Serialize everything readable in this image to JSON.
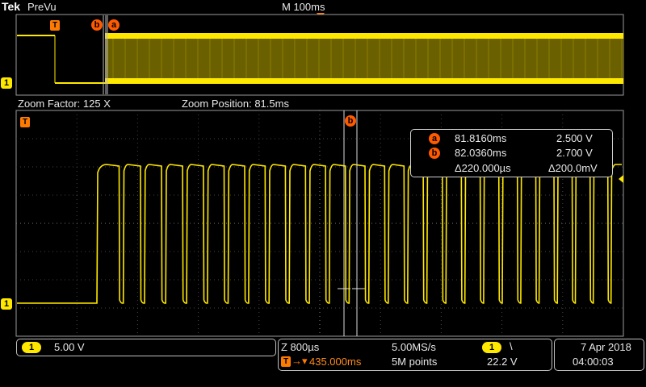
{
  "header": {
    "logo": "Tek",
    "mode": "PreVu",
    "horizontal_scale": "M 100ms"
  },
  "overview": {
    "trigger_marker": "T",
    "cursor_b_marker": "b",
    "cursor_a_marker": "a",
    "channel_marker": "1"
  },
  "zoom": {
    "factor_label": "Zoom Factor: 125 X",
    "position_label": "Zoom Position: 81.5ms",
    "trigger_marker": "T",
    "cursor_b_marker": "b",
    "channel_marker": "1"
  },
  "cursor_readout": {
    "a_label": "a",
    "a_time": "81.8160ms",
    "a_volt": "2.500 V",
    "b_label": "b",
    "b_time": "82.0360ms",
    "b_volt": "2.700 V",
    "delta_time": "Δ220.000µs",
    "delta_volt": "Δ200.0mV"
  },
  "status": {
    "ch1_badge": "1",
    "ch1_scale": "5.00 V",
    "zoom_time": "Z 800µs",
    "sample_rate": "5.00MS/s",
    "trigger_delay": "435.000ms",
    "record_length": "5M points",
    "trig_channel_badge": "1",
    "trig_slope": "\\",
    "trig_level": "22.2 V",
    "date": "7 Apr  2018",
    "time": "04:00:03"
  },
  "colors": {
    "trace": "#ffe800",
    "marker": "#ff5a00",
    "grid": "#555555"
  }
}
